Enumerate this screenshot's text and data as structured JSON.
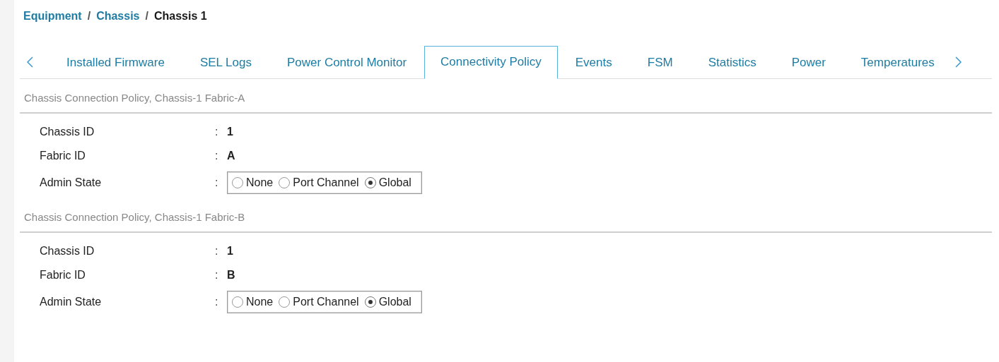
{
  "breadcrumb_separator": "/",
  "breadcrumb": [
    {
      "label": "Equipment",
      "kind": "link"
    },
    {
      "label": "Chassis",
      "kind": "link"
    },
    {
      "label": "Chassis 1",
      "kind": "current"
    }
  ],
  "tabs": [
    {
      "label": "Installed Firmware",
      "selected": false
    },
    {
      "label": "SEL Logs",
      "selected": false
    },
    {
      "label": "Power Control Monitor",
      "selected": false
    },
    {
      "label": "Connectivity Policy",
      "selected": true
    },
    {
      "label": "Events",
      "selected": false
    },
    {
      "label": "FSM",
      "selected": false
    },
    {
      "label": "Statistics",
      "selected": false
    },
    {
      "label": "Power",
      "selected": false
    },
    {
      "label": "Temperatures",
      "selected": false
    }
  ],
  "sections": [
    {
      "title": "Chassis Connection Policy, Chassis-1 Fabric-A",
      "fields": [
        {
          "kind": "text",
          "label": "Chassis ID",
          "separator": ":",
          "value": "1"
        },
        {
          "kind": "text",
          "label": "Fabric ID",
          "separator": ":",
          "value": "A"
        },
        {
          "kind": "radio",
          "label": "Admin State",
          "separator": ":",
          "options": [
            {
              "label": "None",
              "selected": false
            },
            {
              "label": "Port Channel",
              "selected": false
            },
            {
              "label": "Global",
              "selected": true
            }
          ]
        }
      ]
    },
    {
      "title": "Chassis Connection Policy, Chassis-1 Fabric-B",
      "fields": [
        {
          "kind": "text",
          "label": "Chassis ID",
          "separator": ":",
          "value": "1"
        },
        {
          "kind": "text",
          "label": "Fabric ID",
          "separator": ":",
          "value": "B"
        },
        {
          "kind": "radio",
          "label": "Admin State",
          "separator": ":",
          "options": [
            {
              "label": "None",
              "selected": false
            },
            {
              "label": "Port Channel",
              "selected": false
            },
            {
              "label": "Global",
              "selected": true
            }
          ]
        }
      ]
    }
  ]
}
